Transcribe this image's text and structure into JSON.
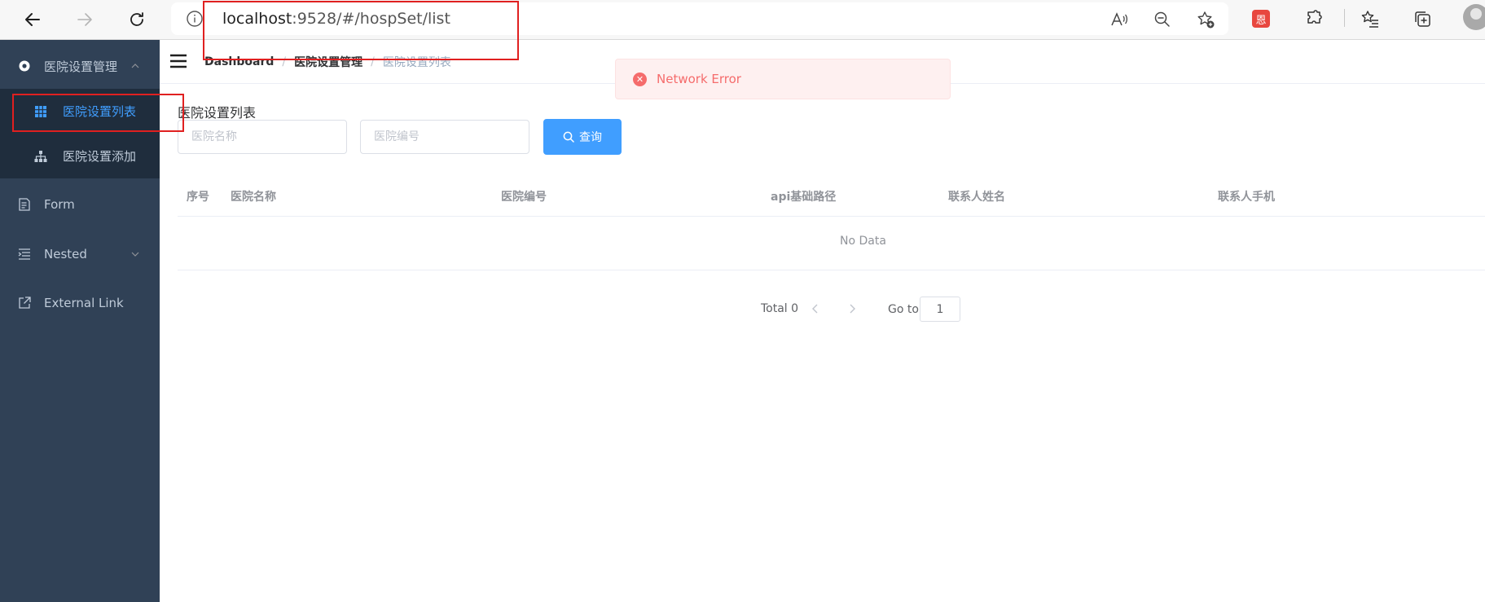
{
  "browser": {
    "url_host": "localhost",
    "url_rest": ":9528/#/hospSet/list",
    "extension_badge_text": "恩"
  },
  "sidebar": {
    "group": {
      "label": "医院设置管理",
      "icon": "gear-icon",
      "expanded": true
    },
    "sub_items": [
      {
        "label": "医院设置列表",
        "icon": "table-icon",
        "active": true
      },
      {
        "label": "医院设置添加",
        "icon": "tree-icon",
        "active": false
      }
    ],
    "items": [
      {
        "label": "Form",
        "icon": "form-icon"
      },
      {
        "label": "Nested",
        "icon": "nested-icon"
      },
      {
        "label": "External Link",
        "icon": "external-link-icon"
      }
    ]
  },
  "breadcrumb": {
    "home": "Dashboard",
    "parent": "医院设置管理",
    "current": "医院设置列表",
    "separator": "/"
  },
  "toast": {
    "type": "error",
    "message": "Network Error"
  },
  "page": {
    "heading": "医院设置列表"
  },
  "search": {
    "name_placeholder": "医院名称",
    "code_placeholder": "医院编号",
    "button_label": "查询"
  },
  "table": {
    "columns": [
      "序号",
      "医院名称",
      "医院编号",
      "api基础路径",
      "联系人姓名",
      "联系人手机"
    ],
    "rows": [],
    "empty_text": "No Data"
  },
  "pagination": {
    "total_text": "Total 0",
    "goto_label": "Go to",
    "current_page": "1"
  },
  "colors": {
    "sidebar_bg": "#304156",
    "submenu_bg": "#1f2d3d",
    "primary": "#409eff",
    "error": "#f56c6c",
    "annotation": "#e02020"
  }
}
